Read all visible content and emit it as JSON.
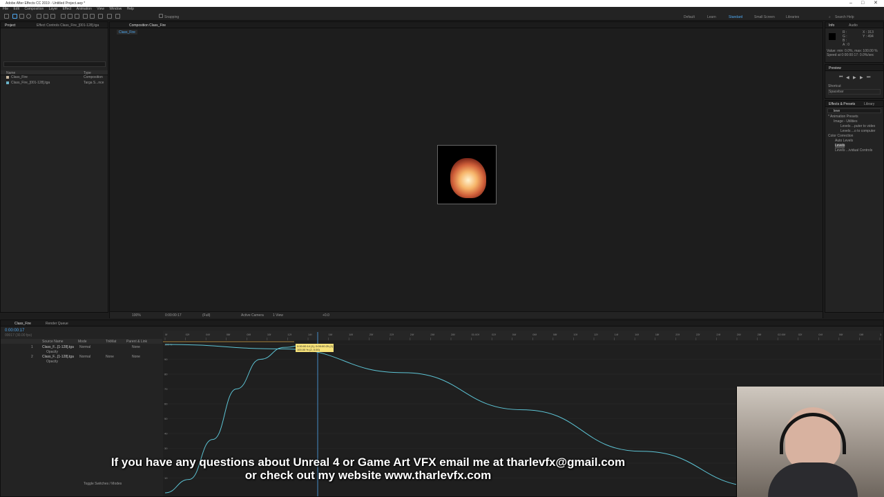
{
  "window": {
    "title": "Adobe After Effects CC 2019 - Untitled Project.aep *",
    "minimize": "–",
    "maximize": "□",
    "close": "✕"
  },
  "menu": [
    "File",
    "Edit",
    "Composition",
    "Layer",
    "Effect",
    "Animation",
    "View",
    "Window",
    "Help"
  ],
  "toolbar": {
    "snapping": "Snapping",
    "workspaces": [
      "Default",
      "Learn",
      "Standard",
      "Small Screen",
      "Libraries"
    ],
    "search_placeholder": "Search Help",
    "icons": [
      "home-icon",
      "selection-icon",
      "hand-icon",
      "zoom-icon",
      "rotate-icon",
      "camera-icon",
      "pan-behind-icon",
      "rectangle-icon",
      "pen-icon",
      "type-icon",
      "brush-icon",
      "clone-icon",
      "eraser-icon",
      "roto-icon",
      "puppet-icon"
    ]
  },
  "project": {
    "tab": "Project",
    "effect_controls_tab": "Effect Controls Class_Fire_[001-128].tga",
    "columns": {
      "name": "Name",
      "type": "Type"
    },
    "items": [
      {
        "name": "Class_Fire",
        "type": "Composition",
        "color": "#c8b8a0"
      },
      {
        "name": "Class_Fire_[001-128].tga",
        "type": "Targa S...nce",
        "color": "#6ab3c9"
      }
    ]
  },
  "composition": {
    "tab": "Composition Class_Fire",
    "breadcrumb": "Class_Fire",
    "footer": {
      "zoom": "100%",
      "timecode": "0:00:00:17",
      "resolution": "(Full)",
      "camera": "Active Camera",
      "views": "1 View",
      "exposure": "+0.0"
    }
  },
  "info": {
    "tab": "Info",
    "audio_tab": "Audio",
    "lines": [
      "R :",
      "G :",
      "B :",
      "A : 0"
    ],
    "coords": [
      "X : 313",
      "Y : 494"
    ],
    "value_line": "Value: min: 0.0%, max: 100.00 %",
    "speed_line": "Speed at 0:00:00:17: 0.0%/sec"
  },
  "preview": {
    "tab": "Preview",
    "shortcut_label": "Shortcut",
    "shortcut_value": "Spacebar"
  },
  "effects": {
    "tab": "Effects & Presets",
    "library_tab": "Library",
    "search": "leve",
    "tree": [
      {
        "label": "* Animation Presets",
        "indent": 0
      },
      {
        "label": "Image - Utilities",
        "indent": 1
      },
      {
        "label": "Levels ...puter to video",
        "indent": 2
      },
      {
        "label": "Levels ...o to computer",
        "indent": 2
      },
      {
        "label": "Color Correction",
        "indent": 0
      },
      {
        "label": "Auto Levels",
        "indent": 1
      },
      {
        "label": "Levels",
        "indent": 1
      },
      {
        "label": "Levels ...ividual Controls",
        "indent": 1
      }
    ]
  },
  "timeline": {
    "tabs": [
      "Class_Fire",
      "Render Queue"
    ],
    "timecode": "0:00:00:17",
    "fps": "00017 (30.00 fps)",
    "headers": {
      "name": "Source Name",
      "mode": "Mode",
      "trkmat": "TrkMat",
      "parent": "Parent & Link"
    },
    "layers": [
      {
        "num": "1",
        "name": "Class_F...[1-128].tga",
        "mode": "Normal",
        "trkmat": "",
        "parent": "None",
        "prop": "Opacity"
      },
      {
        "num": "2",
        "name": "Class_F...[1-128].tga",
        "mode": "Normal",
        "trkmat": "None",
        "parent": "None",
        "prop": "Opacity"
      }
    ],
    "ruler": [
      "0f",
      "02f",
      "04f",
      "06f",
      "08f",
      "10f",
      "12f",
      "14f",
      "16f",
      "18f",
      "20f",
      "22f",
      "24f",
      "26f",
      "28f",
      "01:00f",
      "02f",
      "04f",
      "06f",
      "08f",
      "10f",
      "12f",
      "14f",
      "16f",
      "18f",
      "20f",
      "22f",
      "24f",
      "26f",
      "28f",
      "02:00f",
      "02f",
      "04f",
      "06f",
      "08f",
      "10f"
    ],
    "tooltip": [
      "0:00:00:14 (1), 0:00:00:25 (2)",
      "100.00 % (2, 0.00)"
    ],
    "footer": "Toggle Switches / Modes"
  },
  "chart_data": {
    "type": "line",
    "x_unit": "frames",
    "xlim": [
      0,
      120
    ],
    "ylim": [
      0,
      100
    ],
    "y_ticks": [
      "100 %",
      "90",
      "80",
      "70",
      "60",
      "50",
      "40",
      "30",
      "20",
      "10"
    ],
    "series": [
      {
        "x": [
          0,
          20,
          40,
          60,
          80,
          100,
          120
        ],
        "values": [
          100,
          97,
          81,
          56,
          28,
          4,
          0
        ]
      },
      {
        "x": [
          0,
          4,
          8,
          12,
          16,
          20,
          24
        ],
        "values": [
          0,
          9,
          36,
          70,
          90,
          98,
          100
        ]
      }
    ]
  },
  "subtitles": {
    "line1": "If you have any questions about Unreal 4 or Game Art VFX email me at tharlevfx@gmail.com",
    "line2": "or check out my website www.tharlevfx.com"
  }
}
